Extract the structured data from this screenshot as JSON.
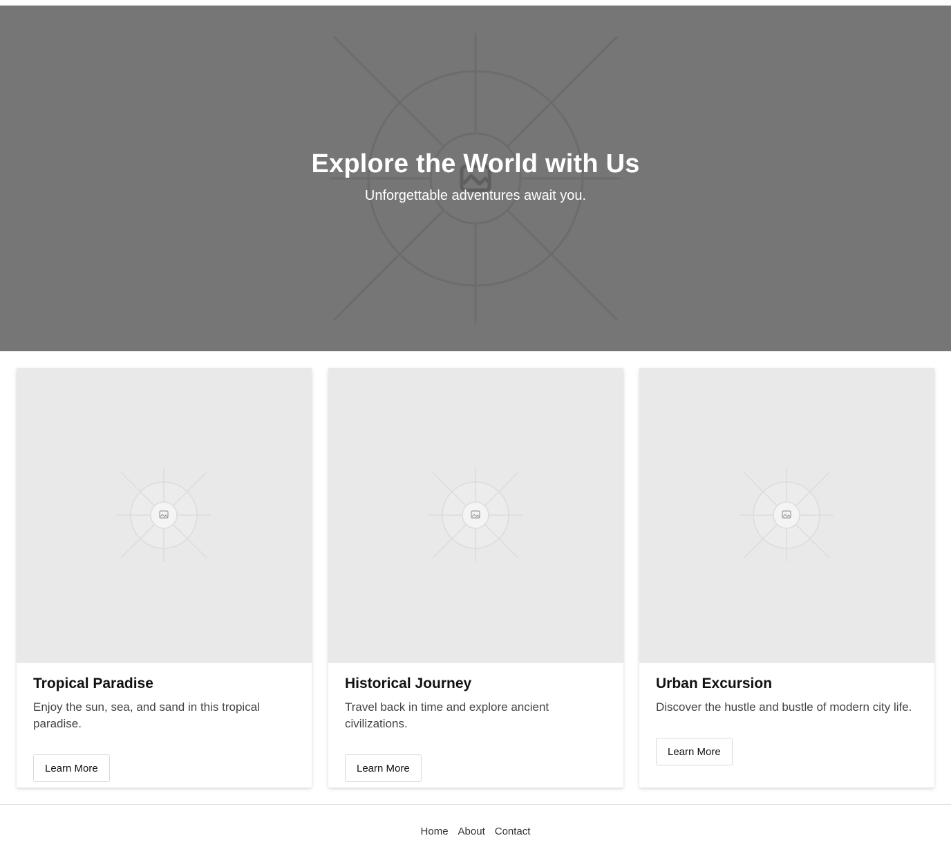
{
  "hero": {
    "title": "Explore the World with Us",
    "subtitle": "Unforgettable adventures await you.",
    "background_color": "#767676"
  },
  "cards": [
    {
      "title": "Tropical Paradise",
      "description": "Enjoy the sun, sea, and sand in this tropical paradise.",
      "button_label": "Learn More"
    },
    {
      "title": "Historical Journey",
      "description": "Travel back in time and explore ancient civilizations.",
      "button_label": "Learn More"
    },
    {
      "title": "Urban Excursion",
      "description": "Discover the hustle and bustle of modern city life.",
      "button_label": "Learn More"
    }
  ],
  "footer": {
    "links": [
      "Home",
      "About",
      "Contact"
    ]
  },
  "icons": {
    "image_placeholder": "image-placeholder-icon"
  }
}
